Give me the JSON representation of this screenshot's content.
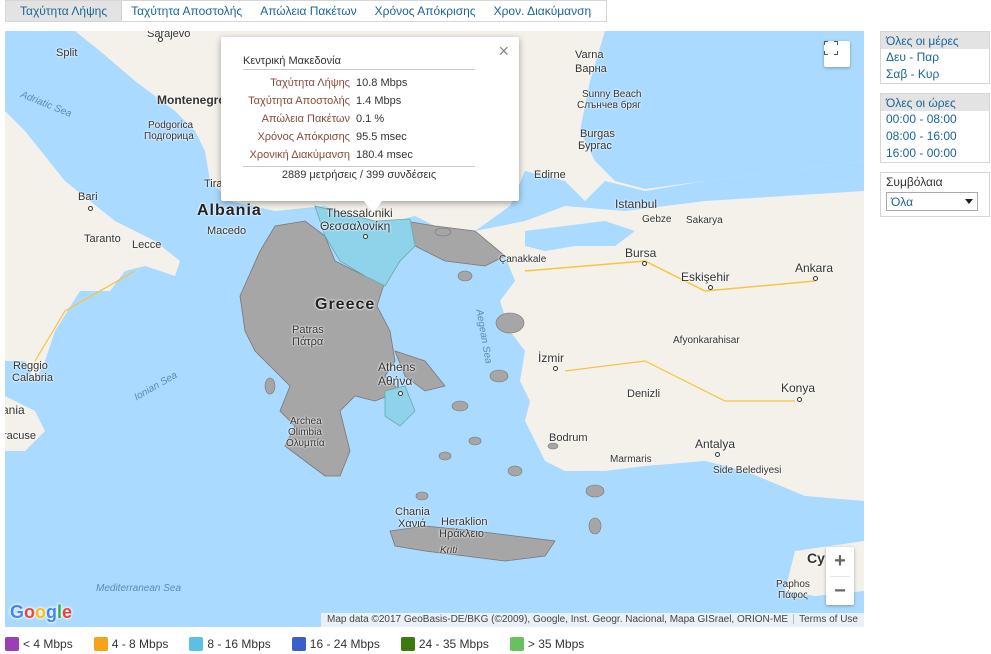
{
  "tabs": [
    {
      "label": "Ταχύτητα Λήψης",
      "active": true
    },
    {
      "label": "Ταχύτητα Αποστολής",
      "active": false
    },
    {
      "label": "Απώλεια Πακέτων",
      "active": false
    },
    {
      "label": "Χρόνος Απόκρισης",
      "active": false
    },
    {
      "label": "Χρον. Διακύμανση",
      "active": false
    }
  ],
  "popup": {
    "title": "Κεντρική Μακεδονία",
    "rows": [
      {
        "label": "Ταχύτητα Λήψης",
        "value": "10.8 Mbps"
      },
      {
        "label": "Ταχύτητα Αποστολής",
        "value": "1.4 Mbps"
      },
      {
        "label": "Απώλεια Πακέτων",
        "value": "0.1 %"
      },
      {
        "label": "Χρόνος Απόκρισης",
        "value": "95.5 msec"
      },
      {
        "label": "Χρονική Διακύμανση",
        "value": "180.4 msec"
      }
    ],
    "footer": "2889 μετρήσεις / 399 συνδέσεις",
    "close_glyph": "×"
  },
  "days_panel": {
    "header": "Όλες οι μέρες",
    "items": [
      "Δευ - Παρ",
      "Σαβ - Κυρ"
    ]
  },
  "hours_panel": {
    "header": "Όλες οι ώρες",
    "items": [
      "00:00 - 08:00",
      "08:00 - 16:00",
      "16:00 - 00:00"
    ]
  },
  "contracts_panel": {
    "label": "Συμβόλαια",
    "selected": "Όλα"
  },
  "legend": [
    {
      "label": "< 4 Mbps",
      "color": "#9b3fb5"
    },
    {
      "label": "4 - 8 Mbps",
      "color": "#f5a31a"
    },
    {
      "label": "8 - 16 Mbps",
      "color": "#5bc0e6"
    },
    {
      "label": "16 - 24 Mbps",
      "color": "#3a5fcd"
    },
    {
      "label": "24 - 35 Mbps",
      "color": "#3d7a10"
    },
    {
      "label": "> 35 Mbps",
      "color": "#6abf5e"
    }
  ],
  "map": {
    "attribution": "Map data ©2017 GeoBasis-DE/BKG (©2009), Google, Inst. Geogr. Nacional, Mapa GISrael, ORION-ME",
    "terms": "Terms of Use",
    "google_logo": "Google",
    "zoom_in": "+",
    "zoom_out": "−",
    "colors": {
      "sea": "#aadaff",
      "land": "#f3f1ea",
      "region_gray": "#a6a6a6",
      "region_blue": "#8fd3ea"
    },
    "labels": {
      "split": "Split",
      "sarajevo": "Sarajevo",
      "varna": "Varna",
      "varna_gr": "Варна",
      "adriatic": "Adriatic Sea",
      "montenegro": "Montenegro",
      "podgorica": "Podgorica",
      "podgorica_gr": "Подгорица",
      "sunny_beach": "Sunny Beach",
      "sunny_beach_gr": "Слънчев бряг",
      "burgas": "Burgas",
      "burgas_gr": "Бургас",
      "tirana": "Tira",
      "edirne": "Edirne",
      "bari": "Bari",
      "albania": "Albania",
      "istanbul": "Istanbul",
      "gebze": "Gebze",
      "sakarya": "Sakarya",
      "macedonia": "Macedo",
      "taranto": "Taranto",
      "lecce": "Lecce",
      "thessaloniki": "Thessaloniki",
      "thessaloniki_gr": "Θεσσαλονίκη",
      "canakkale": "Çanakkale",
      "bursa": "Bursa",
      "eskisehir": "Eskişehir",
      "ankara": "Ankara",
      "greece": "Greece",
      "aegean": "Aegean Sea",
      "reggio": "Reggio",
      "calabria": "Calabria",
      "patras": "Patras",
      "patras_gr": "Πάτρα",
      "izmir": "İzmir",
      "afyon": "Afyonkarahisar",
      "ionian": "Ionian Sea",
      "athens": "Athens",
      "athens_gr": "Αθήνα",
      "denizli": "Denizli",
      "konya": "Konya",
      "ania": "ania",
      "arhea": "Archea",
      "olimbia": "Olimbia",
      "olimbia_gr": "Ολυμπία",
      "bodrum": "Bodrum",
      "antalya": "Antalya",
      "racuse": "racuse",
      "marmaris": "Marmaris",
      "side": "Side Belediyesi",
      "chania": "Chania",
      "chania_gr": "Χανιά",
      "heraklion": "Heraklion",
      "heraklion_gr": "Ηράκλειο",
      "kriti": "Kriti",
      "med": "Mediterranean Sea",
      "cy": "Cy",
      "paphos": "Paphos",
      "paphos_gr": "Πάφος"
    }
  }
}
